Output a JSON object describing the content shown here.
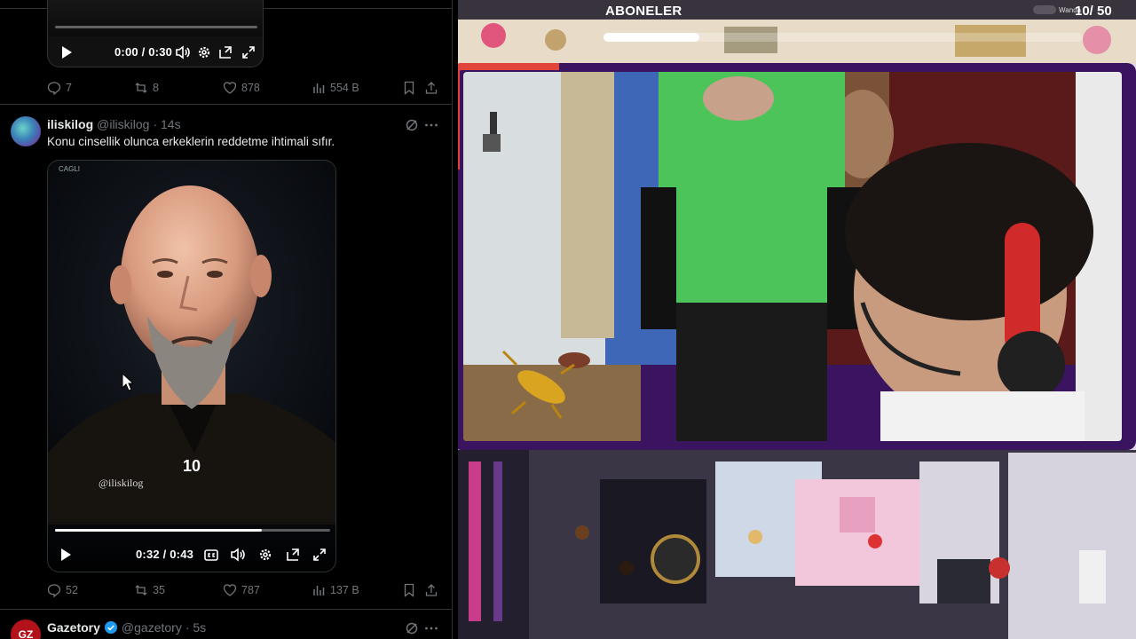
{
  "feed": {
    "top_video": {
      "time": "0:00 / 0:30",
      "progress": 0.0,
      "icons": [
        "play-icon",
        "volume-icon",
        "settings-icon",
        "pip-icon",
        "fullscreen-icon"
      ]
    },
    "top_actions": {
      "replies": "7",
      "reposts": "8",
      "likes": "878",
      "views": "554 B"
    },
    "tweet": {
      "name": "iliskilog",
      "handle": "@iliskilog",
      "time": "· 14s",
      "text": "Konu cinsellik olunca erkeklerin reddetme ihtimali sıfır.",
      "video": {
        "overlay_number": "10",
        "watermark": "@iliskilog",
        "time": "0:32 / 0:43",
        "progress": 0.75,
        "icons": [
          "play-icon",
          "captions-icon",
          "volume-icon",
          "settings-icon",
          "pip-icon",
          "fullscreen-icon"
        ]
      },
      "actions": {
        "replies": "52",
        "reposts": "35",
        "likes": "787",
        "views": "137 B"
      }
    },
    "next_tweet": {
      "name": "Gazetory",
      "handle": "@gazetory",
      "time": "· 5s",
      "avatar_text": "GZ",
      "verified": true
    }
  },
  "stream": {
    "subscribers_title": "ABONELER",
    "subscribers_counter": "10/ 50",
    "toggle_label": "Wanda",
    "subscribers_progress": 0.2
  },
  "colors": {
    "accent_blue": "#1d9bf0",
    "cam_frame_purple": "#3b1460",
    "overlay_bar": "#38333c"
  }
}
